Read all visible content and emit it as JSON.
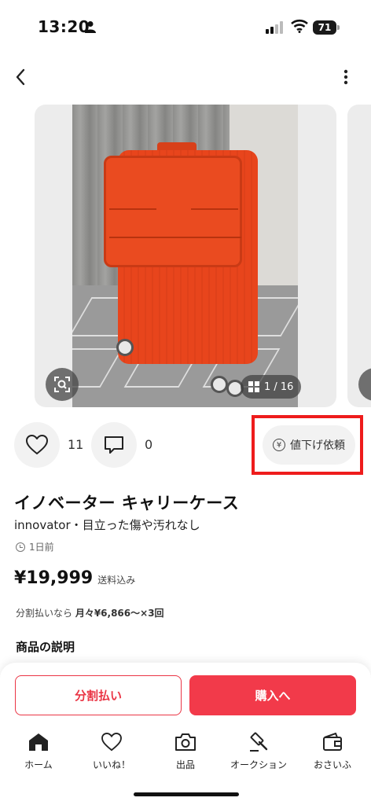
{
  "status_bar": {
    "time": "13:20",
    "battery": "71"
  },
  "nav": {
    "back_icon": "chevron-left-icon",
    "more_icon": "vertical-dots-icon"
  },
  "carousel": {
    "counter": "1 / 16"
  },
  "actions": {
    "like_count": "11",
    "comment_count": "0",
    "price_down_label": "値下げ依頼",
    "yen_symbol": "¥"
  },
  "item": {
    "title": "イノベーター キャリーケース",
    "subtitle": "innovator・目立った傷や汚れなし",
    "posted": "1日前",
    "price": "¥19,999",
    "shipping": "送料込み",
    "installment_prefix": "分割払いなら ",
    "installment_value": "月々¥6,866〜×3回"
  },
  "description": {
    "title": "商品の説明"
  },
  "purchase": {
    "installment_button": "分割払い",
    "buy_button": "購入へ"
  },
  "tabs": [
    {
      "label": "ホーム",
      "icon": "home-icon"
    },
    {
      "label": "いいね！",
      "icon": "heart-icon"
    },
    {
      "label": "出品",
      "icon": "camera-icon"
    },
    {
      "label": "オークション",
      "icon": "gavel-icon"
    },
    {
      "label": "おさいふ",
      "icon": "wallet-icon"
    }
  ],
  "colors": {
    "accent": "#f23a4a",
    "highlight": "#ee1c1c"
  }
}
